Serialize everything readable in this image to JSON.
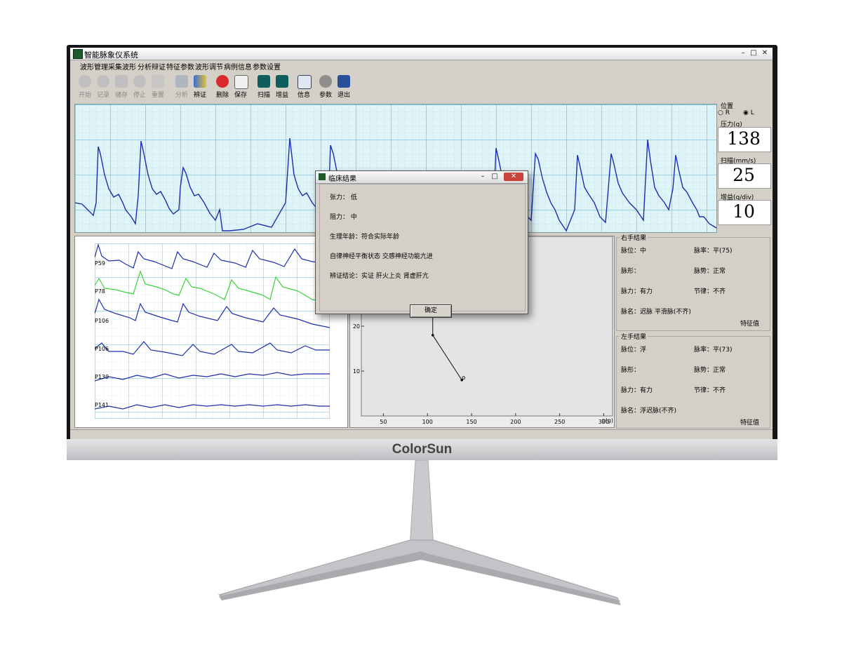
{
  "window": {
    "title": "智能脉象仪系统",
    "min": "–",
    "max": "□",
    "close": "✕"
  },
  "menu": [
    "波形管理",
    "采集波形",
    "分析辩证",
    "特征参数",
    "波形调节",
    "病例信息",
    "参数设置"
  ],
  "toolbar": [
    {
      "label": "开始",
      "enabled": false,
      "icon": "start-icon"
    },
    {
      "label": "记录",
      "enabled": false,
      "icon": "record-icon"
    },
    {
      "label": "储存",
      "enabled": false,
      "icon": "disk-icon"
    },
    {
      "label": "停止",
      "enabled": false,
      "icon": "stop-icon"
    },
    {
      "label": "重置",
      "enabled": false,
      "icon": "reset-icon"
    },
    {
      "label": "分析",
      "enabled": false,
      "icon": "analyze-icon"
    },
    {
      "label": "辨证",
      "enabled": true,
      "icon": "chart-icon"
    },
    {
      "label": "删除",
      "enabled": true,
      "icon": "delete-icon"
    },
    {
      "label": "保存",
      "enabled": true,
      "icon": "save-icon"
    },
    {
      "label": "扫描",
      "enabled": true,
      "icon": "scan-icon"
    },
    {
      "label": "增益",
      "enabled": true,
      "icon": "gain-icon"
    },
    {
      "label": "信息",
      "enabled": true,
      "icon": "info-icon"
    },
    {
      "label": "参数",
      "enabled": true,
      "icon": "settings-icon"
    },
    {
      "label": "退出",
      "enabled": true,
      "icon": "exit-icon"
    }
  ],
  "position": {
    "title": "位置",
    "option_r": "R",
    "option_l": "L",
    "selected": "L"
  },
  "pressure": {
    "label": "压力(g)",
    "value": "138"
  },
  "scan": {
    "label": "扫描(mm/s)",
    "value": "25"
  },
  "gain": {
    "label": "增益(g/div)",
    "value": "10"
  },
  "multi_wave": {
    "labels": [
      "P59",
      "P78",
      "P106",
      "P106",
      "P139",
      "P141"
    ]
  },
  "chart_data": {
    "type": "line",
    "x_ticks": [
      "50",
      "100",
      "150",
      "200",
      "250",
      "300"
    ],
    "y_ticks": [
      "10",
      "20",
      "30"
    ],
    "xlabel": "p(g)",
    "xlim": [
      25,
      310
    ],
    "ylim": [
      0,
      40
    ],
    "points": [
      [
        59,
        29
      ],
      [
        78,
        42
      ],
      [
        106,
        42
      ],
      [
        106,
        18
      ],
      [
        139,
        8
      ],
      [
        141,
        8.5
      ]
    ]
  },
  "right_result": {
    "title": "右手结果",
    "pulse_position": "脉位：中",
    "pulse_rate": "脉率：平(75)",
    "pulse_shape": "脉形：",
    "pulse_trend": "脉势：正常",
    "pulse_force": "脉力：有力",
    "rhythm": "节律：不齐",
    "pulse_name": "脉名：迟脉 平滑脉(不齐)",
    "feature_value": "特征值"
  },
  "left_result": {
    "title": "左手结果",
    "pulse_position": "脉位：浮",
    "pulse_rate": "脉率：平(73)",
    "pulse_shape": "脉形：",
    "pulse_trend": "脉势：正常",
    "pulse_force": "脉力：有力",
    "rhythm": "节律：不齐",
    "pulse_name": "脉名：浮迟脉(不齐)",
    "feature_value": "特征值"
  },
  "dialog": {
    "title": "临床结果",
    "tension": "张力：  低",
    "resistance": "阻力：  中",
    "physio_age": "生理年龄：符合实际年龄",
    "ans_state": "自律神经平衡状态    交感神经功能亢进",
    "conclusion": "辨证结论：实证 肝火上炎 肾虚肝亢",
    "ok": "确定"
  },
  "monitor": {
    "brand": "ColorSun"
  },
  "colors": {
    "wave_blue": "#1c2eb0",
    "wave_green": "#3ad43a",
    "grid": "#5fc2d6",
    "panel": "#d4d0c8"
  }
}
